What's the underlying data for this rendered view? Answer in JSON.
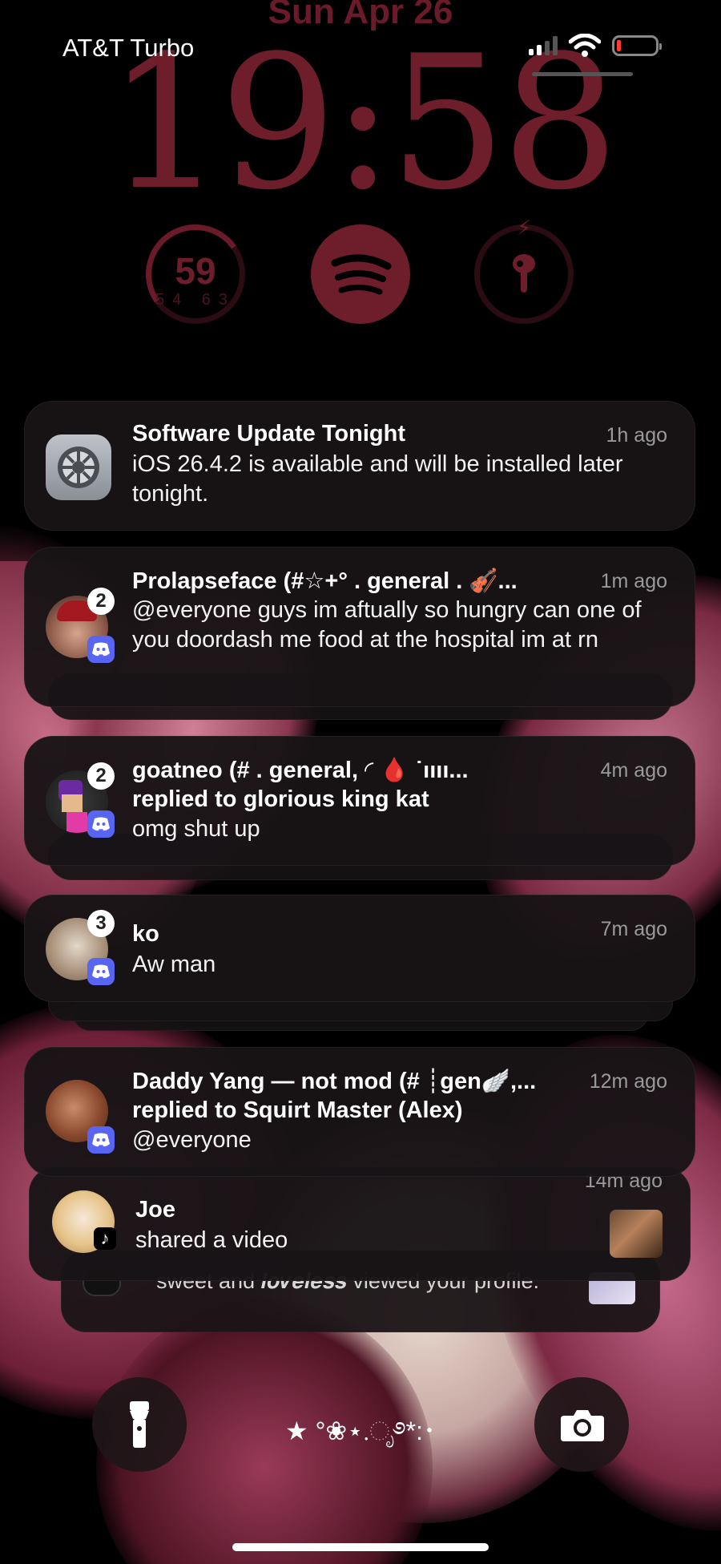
{
  "status_bar": {
    "carrier": "AT&T Turbo",
    "battery_level": 0.08,
    "battery_color": "#ff3b30",
    "signal_bars": 2
  },
  "lock_screen": {
    "date": "Sun Apr 26",
    "time": "19:58",
    "accent_color": "#6e1d2b"
  },
  "widgets": {
    "weather": {
      "temp": "59",
      "low": "54",
      "high": "63"
    },
    "spotify": {
      "icon": "spotify-icon"
    },
    "airpods": {
      "icon": "airpods-icon"
    }
  },
  "notifications": [
    {
      "app": "Settings",
      "icon": "settings-gear-icon",
      "title": "Software Update Tonight",
      "time": "1h ago",
      "body": "iOS 26.4.2 is available and will be installed later tonight."
    },
    {
      "app": "Discord",
      "icon": "discord-icon",
      "title": "Prolapseface (#☆+° . general . 🎻...",
      "time": "1m ago",
      "badge": "2",
      "body": "@everyone guys im aftually so hungry can one of you doordash me food at the hospital im at rn"
    },
    {
      "app": "Discord",
      "icon": "discord-icon",
      "title": "goatneo (# . general, ◜ 🩸 ˙ıııı...",
      "time": "4m ago",
      "badge": "2",
      "subtitle": "replied to glorious king kat",
      "body": "omg shut up"
    },
    {
      "app": "Discord",
      "icon": "discord-icon",
      "title": "ko",
      "time": "7m ago",
      "badge": "3",
      "body": "Aw man"
    },
    {
      "app": "Discord",
      "icon": "discord-icon",
      "title": "Daddy Yang — not mod (# ┊gen🪽,...",
      "time": "12m ago",
      "subtitle": "replied to Squirt Master (Alex)",
      "body": "@everyone"
    },
    {
      "app": "TikTok",
      "icon": "tiktok-icon",
      "title": "Joe",
      "time": "14m ago",
      "body": "shared a video"
    },
    {
      "app": "TikTok",
      "icon": "tiktok-icon",
      "body": "sweet and 𝒍𝒐𝒗𝒆𝒍𝒆𝒔𝒔 viewed your profile."
    }
  ],
  "bottom_bar": {
    "flashlight": "flashlight-icon",
    "camera": "camera-icon",
    "lock_message": "★ °❀⋆.ೃ࿔*:･"
  }
}
